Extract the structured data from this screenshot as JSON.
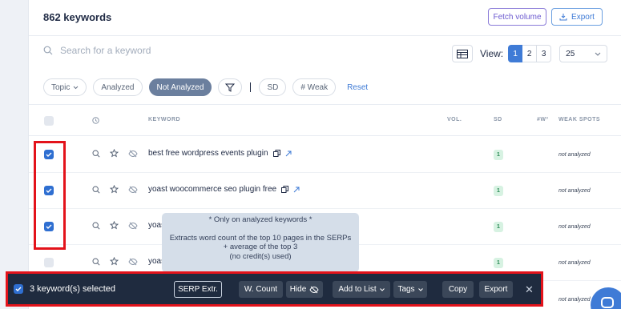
{
  "header": {
    "keyword_count": "862 keywords",
    "fetch_volume_label": "Fetch volume",
    "export_label": "Export"
  },
  "search": {
    "placeholder": "Search for a keyword"
  },
  "view": {
    "label": "View:",
    "pages": [
      "1",
      "2",
      "3"
    ],
    "active_page": "1",
    "per_page": "25"
  },
  "filters": {
    "topic": "Topic",
    "analyzed": "Analyzed",
    "not_analyzed": "Not Analyzed",
    "sd": "SD",
    "weak": "# Weak",
    "reset": "Reset"
  },
  "table": {
    "columns": {
      "keyword": "KEYWORD",
      "vol": "VOL.",
      "sd": "SD",
      "w3": "#W³",
      "weak_spots": "WEAK SPOTS"
    },
    "rows": [
      {
        "keyword": "best free wordpress events plugin",
        "sd": "1",
        "weak_spots": "not analyzed",
        "checked": true
      },
      {
        "keyword": "yoast woocommerce seo plugin free",
        "sd": "1",
        "weak_spots": "not analyzed",
        "checked": true
      },
      {
        "keyword": "yoas",
        "sd": "1",
        "weak_spots": "not analyzed",
        "checked": true
      },
      {
        "keyword": "yoas",
        "sd": "1",
        "weak_spots": "not analyzed",
        "checked": false
      },
      {
        "keyword": "",
        "sd": "",
        "weak_spots": "not analyzed",
        "checked": false
      }
    ]
  },
  "tooltip": {
    "line1": "* Only on analyzed keywords *",
    "line2": "Extracts word count of the top 10 pages in the SERPs",
    "line3": "+ average of the top 3",
    "line4": "(no credit(s) used)"
  },
  "bulk_bar": {
    "selected_text": "3 keyword(s) selected",
    "serp_extr": "SERP Extr.",
    "w_count": "W. Count",
    "hide": "Hide",
    "add_to_list": "Add to List",
    "tags": "Tags",
    "copy": "Copy",
    "export": "Export",
    "close": "✕"
  },
  "colors": {
    "accent": "#3f7bd6",
    "bar_bg": "#1f2b3f",
    "highlight": "#e3131b",
    "sd_badge": "#d7f2e2"
  }
}
